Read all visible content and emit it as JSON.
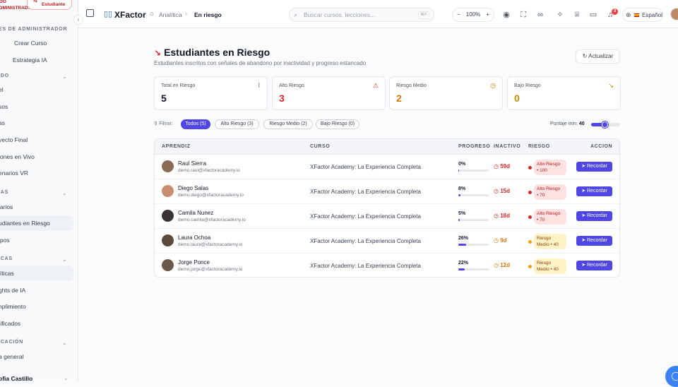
{
  "sidebar": {
    "mode_label": "ODO ADMINISTRADOR",
    "student_button": "Estudiante",
    "sections": [
      {
        "title": "ES DE ADMINISTRADOR",
        "chevron": false
      },
      {
        "title": "IDO",
        "chevron": true
      },
      {
        "title": "IAS",
        "chevron": true
      },
      {
        "title": "ICAS",
        "chevron": true
      },
      {
        "title": "ICACIÓN",
        "chevron": true
      }
    ],
    "items": [
      "Crear Curso",
      "Estrategia IA",
      "el",
      "sos",
      "as",
      "yecto Final",
      "iones en Vivo",
      "enarios VR",
      "iarios",
      "udiantes en Riesgo",
      "ipos",
      "líticas",
      "ghts de IA",
      "nplimiento",
      "tificados",
      "a general"
    ],
    "user_name": "ofia Castillo"
  },
  "topbar": {
    "brand": "XFactor",
    "breadcrumb_home": "Analítica",
    "breadcrumb_current": "En riesgo",
    "search_placeholder": "Buscar cursos, lecciones...",
    "search_shortcut": "⌘K",
    "zoom": "100%",
    "zoom_minus": "−",
    "zoom_plus": "+",
    "notifications_count": "3",
    "language": "Español"
  },
  "page": {
    "title": "Estudiantes en Riesgo",
    "subtitle": "Estudiantes inscritos con señales de abandono por inactividad y progreso estancado",
    "refresh_label": "Actualizar"
  },
  "stats": [
    {
      "label": "Total en Riesgo",
      "value": "5",
      "color": "#111827",
      "icon": "activity-icon",
      "icon_glyph": "⌇",
      "icon_color": "#6b7280"
    },
    {
      "label": "Alto Riesgo",
      "value": "3",
      "color": "#dc2626",
      "icon": "warning-icon",
      "icon_glyph": "⚠",
      "icon_color": "#dc2626"
    },
    {
      "label": "Riesgo Medio",
      "value": "2",
      "color": "#d97706",
      "icon": "clock-icon",
      "icon_glyph": "◷",
      "icon_color": "#d97706"
    },
    {
      "label": "Bajo Riesgo",
      "value": "0",
      "color": "#ca8a04",
      "icon": "trending-down-icon",
      "icon_glyph": "↘",
      "icon_color": "#ca8a04"
    }
  ],
  "filters": {
    "label": "Filtrar:",
    "chips": [
      "Todos (5)",
      "Alto Riesgo (3)",
      "Riesgo Medio (2)",
      "Bajo Riesgo (0)"
    ],
    "active_index": 0,
    "min_score_label": "Puntaje min:",
    "min_score_value": "40",
    "min_score_fraction": 0.4
  },
  "table": {
    "headers": [
      "APRENDIZ",
      "CURSO",
      "PROGRESO",
      "INACTIVO",
      "RIESGO",
      "ACCION"
    ],
    "rows": [
      {
        "name": "Raul Sierra",
        "email": "demo.raul@xfactoracademy.io",
        "course": "XFactor Academy: La Experiencia Completa",
        "progress": "0%",
        "progress_value": 0,
        "inactive": "59d",
        "inactive_color": "#dc2626",
        "risk_line1": "Alto Riesgo",
        "risk_line2": "• 100",
        "risk_level": "alto",
        "action": "Recordar",
        "avatar_color": "#8b6a55"
      },
      {
        "name": "Diego Salas",
        "email": "demo.diego@xfactoracademy.io",
        "course": "XFactor Academy: La Experiencia Completa",
        "progress": "8%",
        "progress_value": 8,
        "inactive": "15d",
        "inactive_color": "#dc2626",
        "risk_line1": "Alto Riesgo",
        "risk_line2": "• 70",
        "risk_level": "alto",
        "action": "Recordar",
        "avatar_color": "#c98d6f"
      },
      {
        "name": "Camila Nunez",
        "email": "demo.camila@xfactoracademy.io",
        "course": "XFactor Academy: La Experiencia Completa",
        "progress": "5%",
        "progress_value": 5,
        "inactive": "18d",
        "inactive_color": "#dc2626",
        "risk_line1": "Alto Riesgo",
        "risk_line2": "• 70",
        "risk_level": "alto",
        "action": "Recordar",
        "avatar_color": "#3a3535"
      },
      {
        "name": "Laura Ochoa",
        "email": "demo.laura@xfactoracademy.io",
        "course": "XFactor Academy: La Experiencia Completa",
        "progress": "26%",
        "progress_value": 26,
        "inactive": "9d",
        "inactive_color": "#d97706",
        "risk_line1": "Riesgo",
        "risk_line2": "Medio • 40",
        "risk_level": "medio",
        "action": "Recordar",
        "avatar_color": "#5e4a3a"
      },
      {
        "name": "Jorge Ponce",
        "email": "demo.jorge@xfactoracademy.io",
        "course": "XFactor Academy: La Experiencia Completa",
        "progress": "22%",
        "progress_value": 22,
        "inactive": "12d",
        "inactive_color": "#d97706",
        "risk_line1": "Riesgo",
        "risk_line2": "Medio • 40",
        "risk_level": "medio",
        "action": "Recordar",
        "avatar_color": "#6b5a4a"
      }
    ]
  },
  "colors": {
    "accent": "#4f46e5",
    "danger": "#dc2626",
    "warning": "#d97706"
  }
}
